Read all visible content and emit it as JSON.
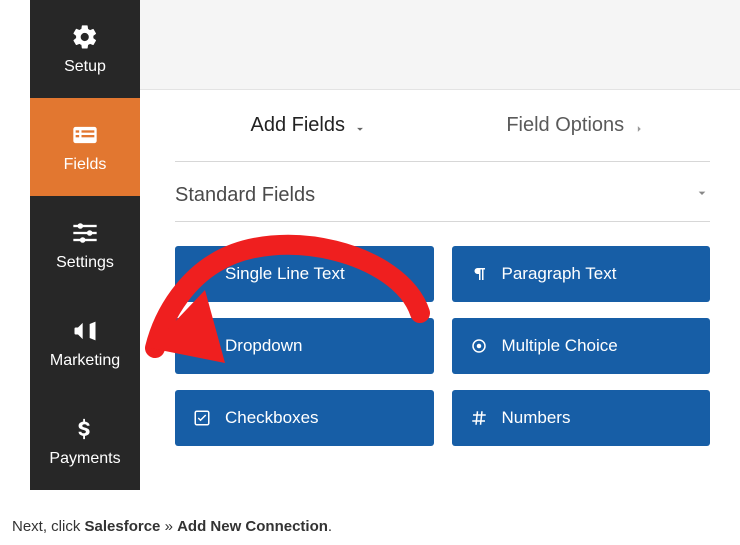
{
  "sidebar": {
    "items": [
      {
        "label": "Setup",
        "active": false
      },
      {
        "label": "Fields",
        "active": true
      },
      {
        "label": "Settings",
        "active": false
      },
      {
        "label": "Marketing",
        "active": false
      },
      {
        "label": "Payments",
        "active": false
      }
    ]
  },
  "tabs": {
    "add_fields": "Add Fields",
    "field_options": "Field Options"
  },
  "section": {
    "title": "Standard Fields"
  },
  "field_buttons": [
    "Single Line Text",
    "Paragraph Text",
    "Dropdown",
    "Multiple Choice",
    "Checkboxes",
    "Numbers"
  ],
  "footer": {
    "prefix": "Next, click ",
    "bold1": "Salesforce",
    "sep": " » ",
    "bold2": "Add New Connection",
    "suffix": "."
  },
  "colors": {
    "accent": "#e27730",
    "field_blue": "#175ea6",
    "sidebar_bg": "#272727"
  }
}
